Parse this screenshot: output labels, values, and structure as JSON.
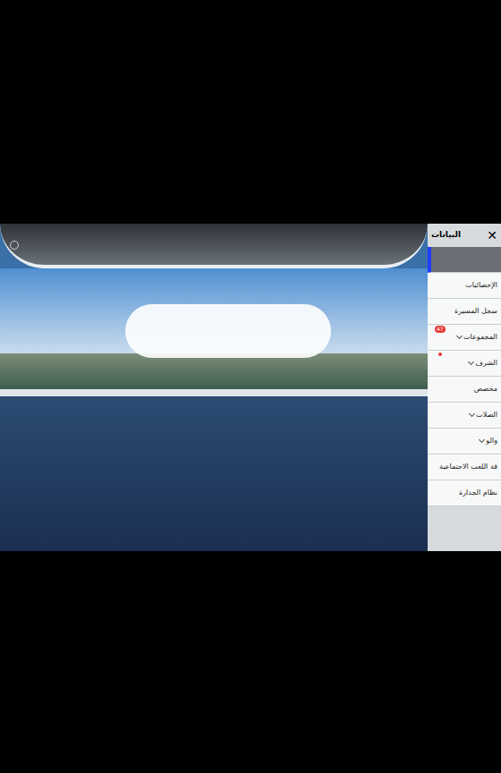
{
  "panel": {
    "title": "البيانات",
    "close": "✕",
    "items": [
      {
        "label": "",
        "selected": true,
        "expandable": false,
        "badge": "",
        "dot": false
      },
      {
        "label": "الإحصائيات",
        "selected": false,
        "expandable": false,
        "badge": "",
        "dot": false
      },
      {
        "label": "سجل المسيرة",
        "selected": false,
        "expandable": false,
        "badge": "",
        "dot": false
      },
      {
        "label": "المجموعات",
        "selected": false,
        "expandable": true,
        "badge": "47",
        "dot": false
      },
      {
        "label": "الشرف",
        "selected": false,
        "expandable": true,
        "badge": "",
        "dot": true
      },
      {
        "label": "مخصص",
        "selected": false,
        "expandable": false,
        "badge": "",
        "dot": false
      },
      {
        "label": "الصلات",
        "selected": false,
        "expandable": true,
        "badge": "",
        "dot": false
      },
      {
        "label": "والو",
        "selected": false,
        "expandable": true,
        "badge": "",
        "dot": false
      },
      {
        "label": "قة اللعب الاجتماعية",
        "selected": false,
        "expandable": false,
        "badge": "",
        "dot": false
      },
      {
        "label": "نظام الجدارة",
        "selected": false,
        "expandable": false,
        "badge": "",
        "dot": false
      }
    ]
  }
}
